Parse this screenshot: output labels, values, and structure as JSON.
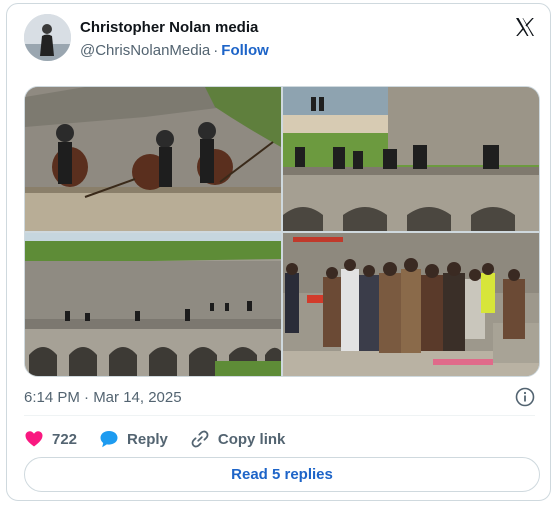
{
  "author": {
    "name": "Christopher Nolan media",
    "handle": "@ChrisNolanMedia",
    "separator": "·",
    "follow_label": "Follow"
  },
  "icons": {
    "platform_logo": "x-logo-icon",
    "info": "info-icon",
    "like": "heart-icon",
    "reply": "speech-bubble-icon",
    "copy": "link-icon"
  },
  "media": [
    {
      "subject": "soldiers-with-crested-helmets-on-fortress-wall"
    },
    {
      "subject": "soldiers-on-arched-bridge-by-beach"
    },
    {
      "subject": "fortress-arches-with-extras"
    },
    {
      "subject": "costumed-crowd-on-set"
    }
  ],
  "timestamp": "6:14 PM · Mar 14, 2025",
  "actions": {
    "like_count": "722",
    "reply_label": "Reply",
    "copy_label": "Copy link"
  },
  "read_replies_label": "Read 5 replies",
  "colors": {
    "accent": "#1d64c8",
    "like": "#f91880",
    "reply": "#1d9bf0",
    "secondary_text": "#536471",
    "border": "#cfd9de"
  }
}
